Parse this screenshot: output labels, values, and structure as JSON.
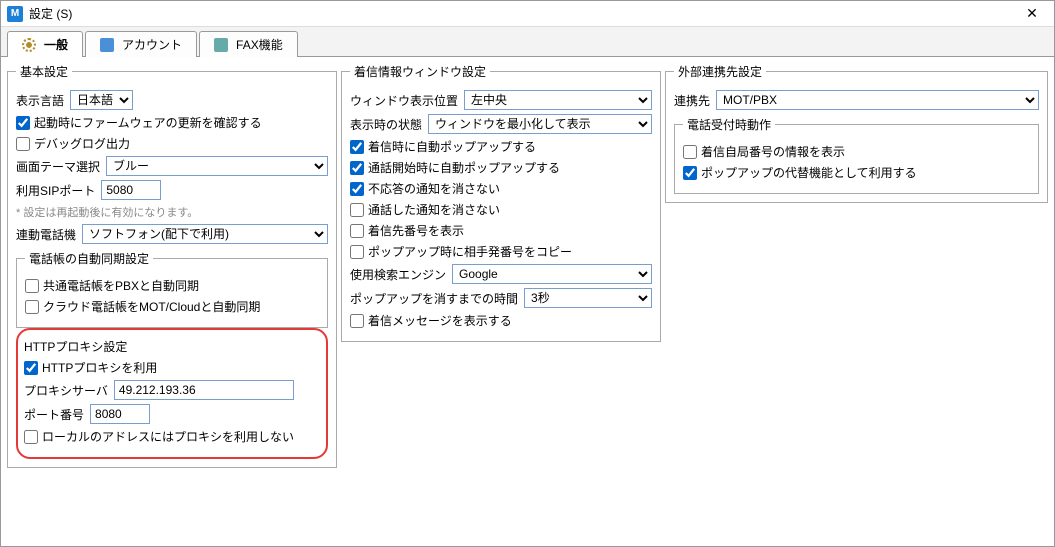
{
  "window": {
    "title": "設定 (S)",
    "icon_letter": "M"
  },
  "tabs": {
    "general": "一般",
    "account": "アカウント",
    "fax": "FAX機能"
  },
  "basic": {
    "legend": "基本設定",
    "lang_label": "表示言語",
    "lang_value": "日本語",
    "chk_firmware": "起動時にファームウェアの更新を確認する",
    "chk_debuglog": "デバッグログ出力",
    "theme_label": "画面テーマ選択",
    "theme_value": "ブルー",
    "sipport_label": "利用SIPポート",
    "sipport_value": "5080",
    "sipport_note": "* 設定は再起動後に有効になります。",
    "phone_label": "連動電話機",
    "phone_value": "ソフトフォン(配下で利用)",
    "sync_legend": "電話帳の自動同期設定",
    "chk_sync_pbx": "共通電話帳をPBXと自動同期",
    "chk_sync_cloud": "クラウド電話帳をMOT/Cloudと自動同期",
    "proxy_legend": "HTTPプロキシ設定",
    "chk_use_proxy": "HTTPプロキシを利用",
    "proxy_server_label": "プロキシサーバ",
    "proxy_server_value": "49.212.193.36",
    "proxy_port_label": "ポート番号",
    "proxy_port_value": "8080",
    "chk_proxy_nolocal": "ローカルのアドレスにはプロキシを利用しない"
  },
  "incoming": {
    "legend": "着信情報ウィンドウ設定",
    "pos_label": "ウィンドウ表示位置",
    "pos_value": "左中央",
    "state_label": "表示時の状態",
    "state_value": "ウィンドウを最小化して表示",
    "chk_popup_incoming": "着信時に自動ポップアップする",
    "chk_popup_callstart": "通話開始時に自動ポップアップする",
    "chk_keep_missed": "不応答の通知を消さない",
    "chk_keep_called": "通話した通知を消さない",
    "chk_show_priority": "着信先番号を表示",
    "chk_copy_caller": "ポップアップ時に相手発番号をコピー",
    "search_label": "使用検索エンジン",
    "search_value": "Google",
    "dismiss_label": "ポップアップを消すまでの時間",
    "dismiss_value": "3秒",
    "chk_show_msg": "着信メッセージを表示する"
  },
  "external": {
    "legend": "外部連携先設定",
    "link_label": "連携先",
    "link_value": "MOT/PBX",
    "recv_legend": "電話受付時動作",
    "chk_show_selfnum": "着信自局番号の情報を表示",
    "chk_popup_alt": "ポップアップの代替機能として利用する"
  }
}
